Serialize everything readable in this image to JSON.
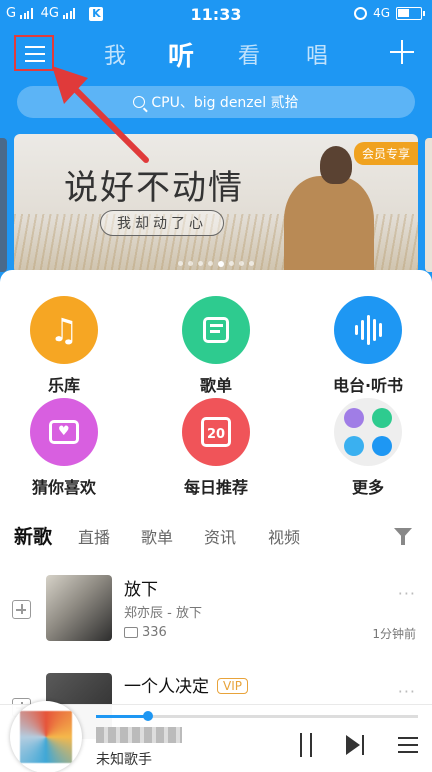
{
  "status_bar": {
    "carrier_left": "G",
    "network_label": "4G",
    "app_badge": "K",
    "time": "11:33",
    "network_right": "4G"
  },
  "top_nav": {
    "tabs": [
      "我",
      "听",
      "看",
      "唱"
    ],
    "active_tab": "听"
  },
  "search": {
    "placeholder": "CPU、big denzel 贰拾"
  },
  "banner": {
    "title": "说好不动情",
    "subtitle": "我却动了心",
    "tag": "会员专享",
    "slide_index": 4,
    "slide_count": 8
  },
  "quick_entries": [
    {
      "label": "乐库",
      "icon": "music-note-icon",
      "color": "#f6a623"
    },
    {
      "label": "歌单",
      "icon": "playlist-icon",
      "color": "#2ecb8f"
    },
    {
      "label": "电台·听书",
      "icon": "sound-wave-icon",
      "color": "#1e97f3"
    },
    {
      "label": "猜你喜欢",
      "icon": "radio-heart-icon",
      "color": "#d85fe0"
    },
    {
      "label": "每日推荐",
      "icon": "calendar-icon",
      "color": "#f05459"
    },
    {
      "label": "更多",
      "icon": "more-apps-icon",
      "color": "#eeeeee"
    }
  ],
  "daily_date": "20",
  "content_tabs": [
    "新歌",
    "直播",
    "歌单",
    "资讯",
    "视频"
  ],
  "active_content_tab": "新歌",
  "songs": [
    {
      "title": "放下",
      "meta": "郑亦辰 - 放下",
      "comments": "336",
      "time": "1分钟前",
      "vip": ""
    },
    {
      "title": "一个人决定",
      "meta": "",
      "comments": "",
      "time": "",
      "vip": "VIP"
    }
  ],
  "more_dots": "···",
  "player": {
    "artist": "未知歌手",
    "progress": 0.16,
    "accent": "#1e97f3"
  }
}
